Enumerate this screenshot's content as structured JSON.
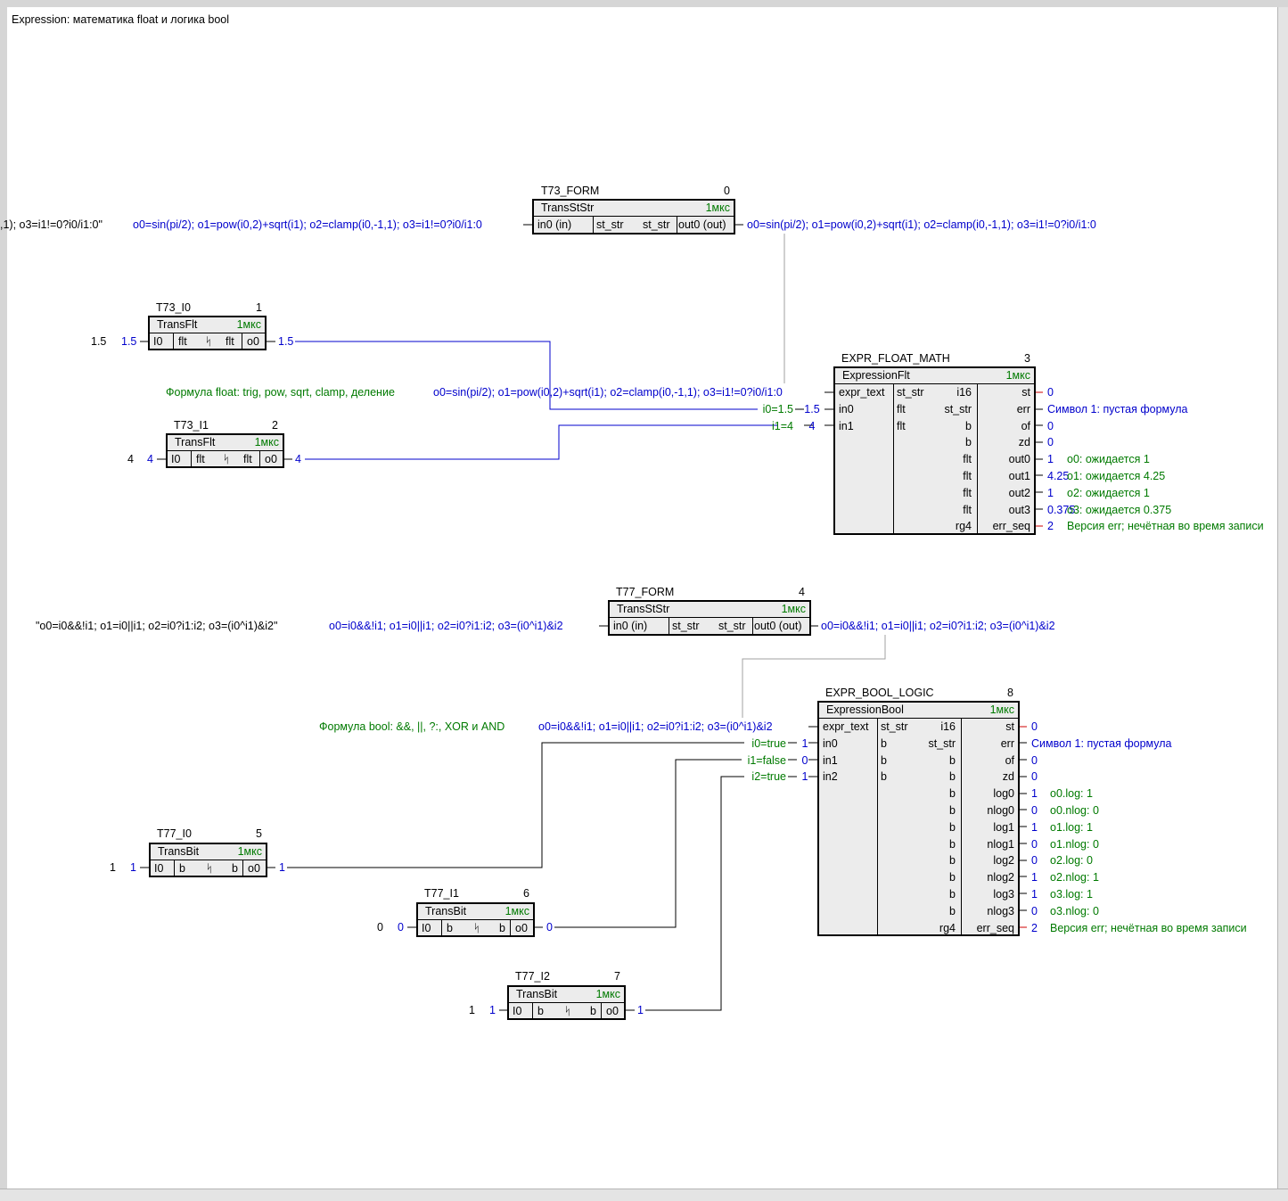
{
  "page_title": "Expression: математика float и логика bool",
  "colors": {
    "wire_blue": "#0000cc",
    "wire_gray": "#a0a0a0",
    "green": "#007a00",
    "red": "#cc0000",
    "block_fill": "#ececec"
  },
  "t73_form": {
    "name": "T73_FORM",
    "num": "0",
    "type": "TransStStr",
    "cycle": "1мкс",
    "in0": "in0 (in)",
    "c1": "st_str",
    "c2": "st_str",
    "out0": "out0 (out)",
    "input_literal": ",1); o3=i1!=0?i0/i1:0\"",
    "input_value": "o0=sin(pi/2); o1=pow(i0,2)+sqrt(i1); o2=clamp(i0,-1,1); o3=i1!=0?i0/i1:0",
    "output_value": "o0=sin(pi/2); o1=pow(i0,2)+sqrt(i1); o2=clamp(i0,-1,1); o3=i1!=0?i0/i1:0"
  },
  "t73_i0": {
    "name": "T73_I0",
    "num": "1",
    "type": "TransFlt",
    "cycle": "1мкс",
    "in": "I0",
    "t1": "flt",
    "sym": "ᛋ",
    "t2": "flt",
    "out": "o0",
    "literal": "1.5",
    "in_val": "1.5",
    "out_val": "1.5"
  },
  "t73_i1": {
    "name": "T73_I1",
    "num": "2",
    "type": "TransFlt",
    "cycle": "1мкс",
    "in": "I0",
    "t1": "flt",
    "sym": "ᛋ",
    "t2": "flt",
    "out": "o0",
    "literal": "4",
    "in_val": "4",
    "out_val": "4"
  },
  "expr_float": {
    "name": "EXPR_FLOAT_MATH",
    "num": "3",
    "type": "ExpressionFlt",
    "cycle": "1мкс",
    "comment": "Формула float: trig, pow, sqrt, clamp, деление",
    "formula": "o0=sin(pi/2); o1=pow(i0,2)+sqrt(i1); o2=clamp(i0,-1,1); o3=i1!=0?i0/i1:0",
    "inputs": [
      {
        "name": "expr_text",
        "type": "st_str",
        "label": "",
        "val": ""
      },
      {
        "name": "in0",
        "type": "flt",
        "label": "i0=1.5",
        "val": "1.5"
      },
      {
        "name": "in1",
        "type": "flt",
        "label": "i1=4",
        "val": "4"
      }
    ],
    "outputs": [
      {
        "type": "i16",
        "name": "st",
        "val": "0",
        "note": ""
      },
      {
        "type": "st_str",
        "name": "err",
        "val": "Символ 1: пустая формула",
        "note": ""
      },
      {
        "type": "b",
        "name": "of",
        "val": "0",
        "note": ""
      },
      {
        "type": "b",
        "name": "zd",
        "val": "0",
        "note": ""
      },
      {
        "type": "flt",
        "name": "out0",
        "val": "1",
        "note": "o0: ожидается 1"
      },
      {
        "type": "flt",
        "name": "out1",
        "val": "4.25",
        "note": "o1: ожидается 4.25"
      },
      {
        "type": "flt",
        "name": "out2",
        "val": "1",
        "note": "o2: ожидается 1"
      },
      {
        "type": "flt",
        "name": "out3",
        "val": "0.375",
        "note": "o3: ожидается 0.375"
      },
      {
        "type": "rg4",
        "name": "err_seq",
        "val": "2",
        "note": "Версия err; нечётная во время записи"
      }
    ]
  },
  "t77_form": {
    "name": "T77_FORM",
    "num": "4",
    "type": "TransStStr",
    "cycle": "1мкс",
    "in0": "in0 (in)",
    "c1": "st_str",
    "c2": "st_str",
    "out0": "out0 (out)",
    "input_literal": "\"o0=i0&&!i1; o1=i0||i1; o2=i0?i1:i2; o3=(i0^i1)&i2\"",
    "input_value": "o0=i0&&!i1; o1=i0||i1; o2=i0?i1:i2; o3=(i0^i1)&i2",
    "output_value": "o0=i0&&!i1; o1=i0||i1; o2=i0?i1:i2; o3=(i0^i1)&i2"
  },
  "t77_i0": {
    "name": "T77_I0",
    "num": "5",
    "type": "TransBit",
    "cycle": "1мкс",
    "in": "I0",
    "t1": "b",
    "sym": "ᛋ",
    "t2": "b",
    "out": "o0",
    "literal": "1",
    "in_val": "1",
    "out_val": "1"
  },
  "t77_i1": {
    "name": "T77_I1",
    "num": "6",
    "type": "TransBit",
    "cycle": "1мкс",
    "in": "I0",
    "t1": "b",
    "sym": "ᛋ",
    "t2": "b",
    "out": "o0",
    "literal": "0",
    "in_val": "0",
    "out_val": "0"
  },
  "t77_i2": {
    "name": "T77_I2",
    "num": "7",
    "type": "TransBit",
    "cycle": "1мкс",
    "in": "I0",
    "t1": "b",
    "sym": "ᛋ",
    "t2": "b",
    "out": "o0",
    "literal": "1",
    "in_val": "1",
    "out_val": "1"
  },
  "expr_bool": {
    "name": "EXPR_BOOL_LOGIC",
    "num": "8",
    "type": "ExpressionBool",
    "cycle": "1мкс",
    "comment": "Формула bool: &&, ||, ?:, XOR и AND",
    "formula": "o0=i0&&!i1; o1=i0||i1; o2=i0?i1:i2; o3=(i0^i1)&i2",
    "inputs": [
      {
        "name": "expr_text",
        "type": "st_str",
        "label": "",
        "val": ""
      },
      {
        "name": "in0",
        "type": "b",
        "label": "i0=true",
        "val": "1"
      },
      {
        "name": "in1",
        "type": "b",
        "label": "i1=false",
        "val": "0"
      },
      {
        "name": "in2",
        "type": "b",
        "label": "i2=true",
        "val": "1"
      }
    ],
    "outputs": [
      {
        "type": "i16",
        "name": "st",
        "val": "0",
        "note": ""
      },
      {
        "type": "st_str",
        "name": "err",
        "val": "Символ 1: пустая формула",
        "note": ""
      },
      {
        "type": "b",
        "name": "of",
        "val": "0",
        "note": ""
      },
      {
        "type": "b",
        "name": "zd",
        "val": "0",
        "note": ""
      },
      {
        "type": "b",
        "name": "log0",
        "val": "1",
        "note": "o0.log: 1"
      },
      {
        "type": "b",
        "name": "nlog0",
        "val": "0",
        "note": "o0.nlog: 0"
      },
      {
        "type": "b",
        "name": "log1",
        "val": "1",
        "note": "o1.log: 1"
      },
      {
        "type": "b",
        "name": "nlog1",
        "val": "0",
        "note": "o1.nlog: 0"
      },
      {
        "type": "b",
        "name": "log2",
        "val": "0",
        "note": "o2.log: 0"
      },
      {
        "type": "b",
        "name": "nlog2",
        "val": "1",
        "note": "o2.nlog: 1"
      },
      {
        "type": "b",
        "name": "log3",
        "val": "1",
        "note": "o3.log: 1"
      },
      {
        "type": "b",
        "name": "nlog3",
        "val": "0",
        "note": "o3.nlog: 0"
      },
      {
        "type": "rg4",
        "name": "err_seq",
        "val": "2",
        "note": "Версия err; нечётная во время записи"
      }
    ]
  }
}
